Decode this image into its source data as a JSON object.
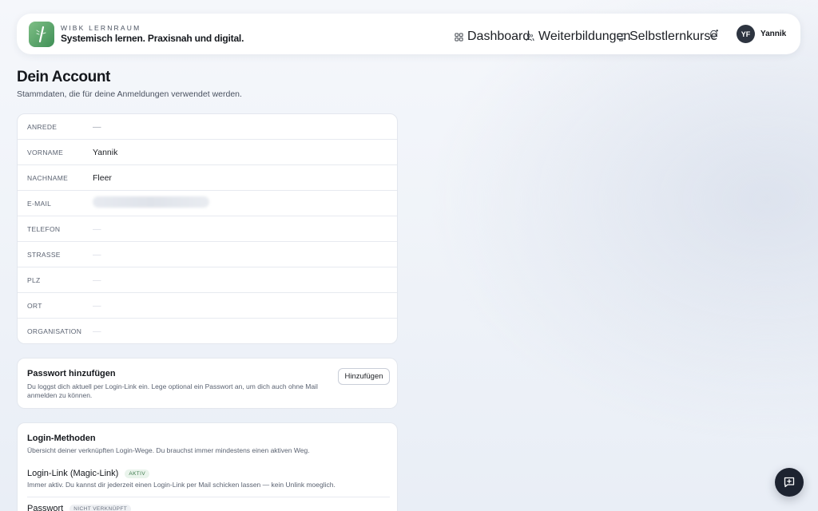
{
  "header": {
    "brand_kicker": "WIBK LERNRAUM",
    "brand_tagline": "Systemisch lernen. Praxisnah und digital.",
    "nav": [
      {
        "label": "Dashboard",
        "icon": "grid-icon"
      },
      {
        "label": "Weiterbildungen",
        "icon": "users-icon"
      },
      {
        "label": "Selbstlernkurse",
        "icon": "monitor-icon"
      }
    ],
    "notification_icon": "bell-icon",
    "user": {
      "initials": "YF",
      "name": "Yannik"
    }
  },
  "page": {
    "title": "Dein Account",
    "subtitle": "Stammdaten, die für deine Anmeldungen verwendet werden."
  },
  "fields": [
    {
      "label": "ANREDE",
      "value": "—"
    },
    {
      "label": "VORNAME",
      "value": "Yannik"
    },
    {
      "label": "NACHNAME",
      "value": "Fleer"
    },
    {
      "label": "E-MAIL",
      "value": ""
    },
    {
      "label": "TELEFON",
      "value": "—"
    },
    {
      "label": "STRASSE",
      "value": "—"
    },
    {
      "label": "PLZ",
      "value": "—"
    },
    {
      "label": "ORT",
      "value": "—"
    },
    {
      "label": "ORGANISATION",
      "value": "—"
    }
  ],
  "password_card": {
    "title": "Passwort hinzufügen",
    "description": "Du loggst dich aktuell per Login-Link ein. Lege optional ein Passwort an, um dich auch ohne Mail anmelden zu können.",
    "button_label": "Hinzufügen"
  },
  "login_methods": {
    "title": "Login-Methoden",
    "description": "Übersicht deiner verknüpften Login-Wege. Du brauchst immer mindestens einen aktiven Weg.",
    "methods": [
      {
        "name": "Login-Link (Magic-Link)",
        "badge": "AKTIV",
        "description": "Immer aktiv. Du kannst dir jederzeit einen Login-Link per Mail schicken lassen — kein Unlink moeglich."
      },
      {
        "name": "Passwort",
        "badge": "NICHT VERKNÜPFT",
        "description": ""
      }
    ]
  },
  "fab": {
    "icon": "chat-plus-icon"
  },
  "colors": {
    "accent_green": "#3f8f56",
    "dark": "#1d2330"
  }
}
